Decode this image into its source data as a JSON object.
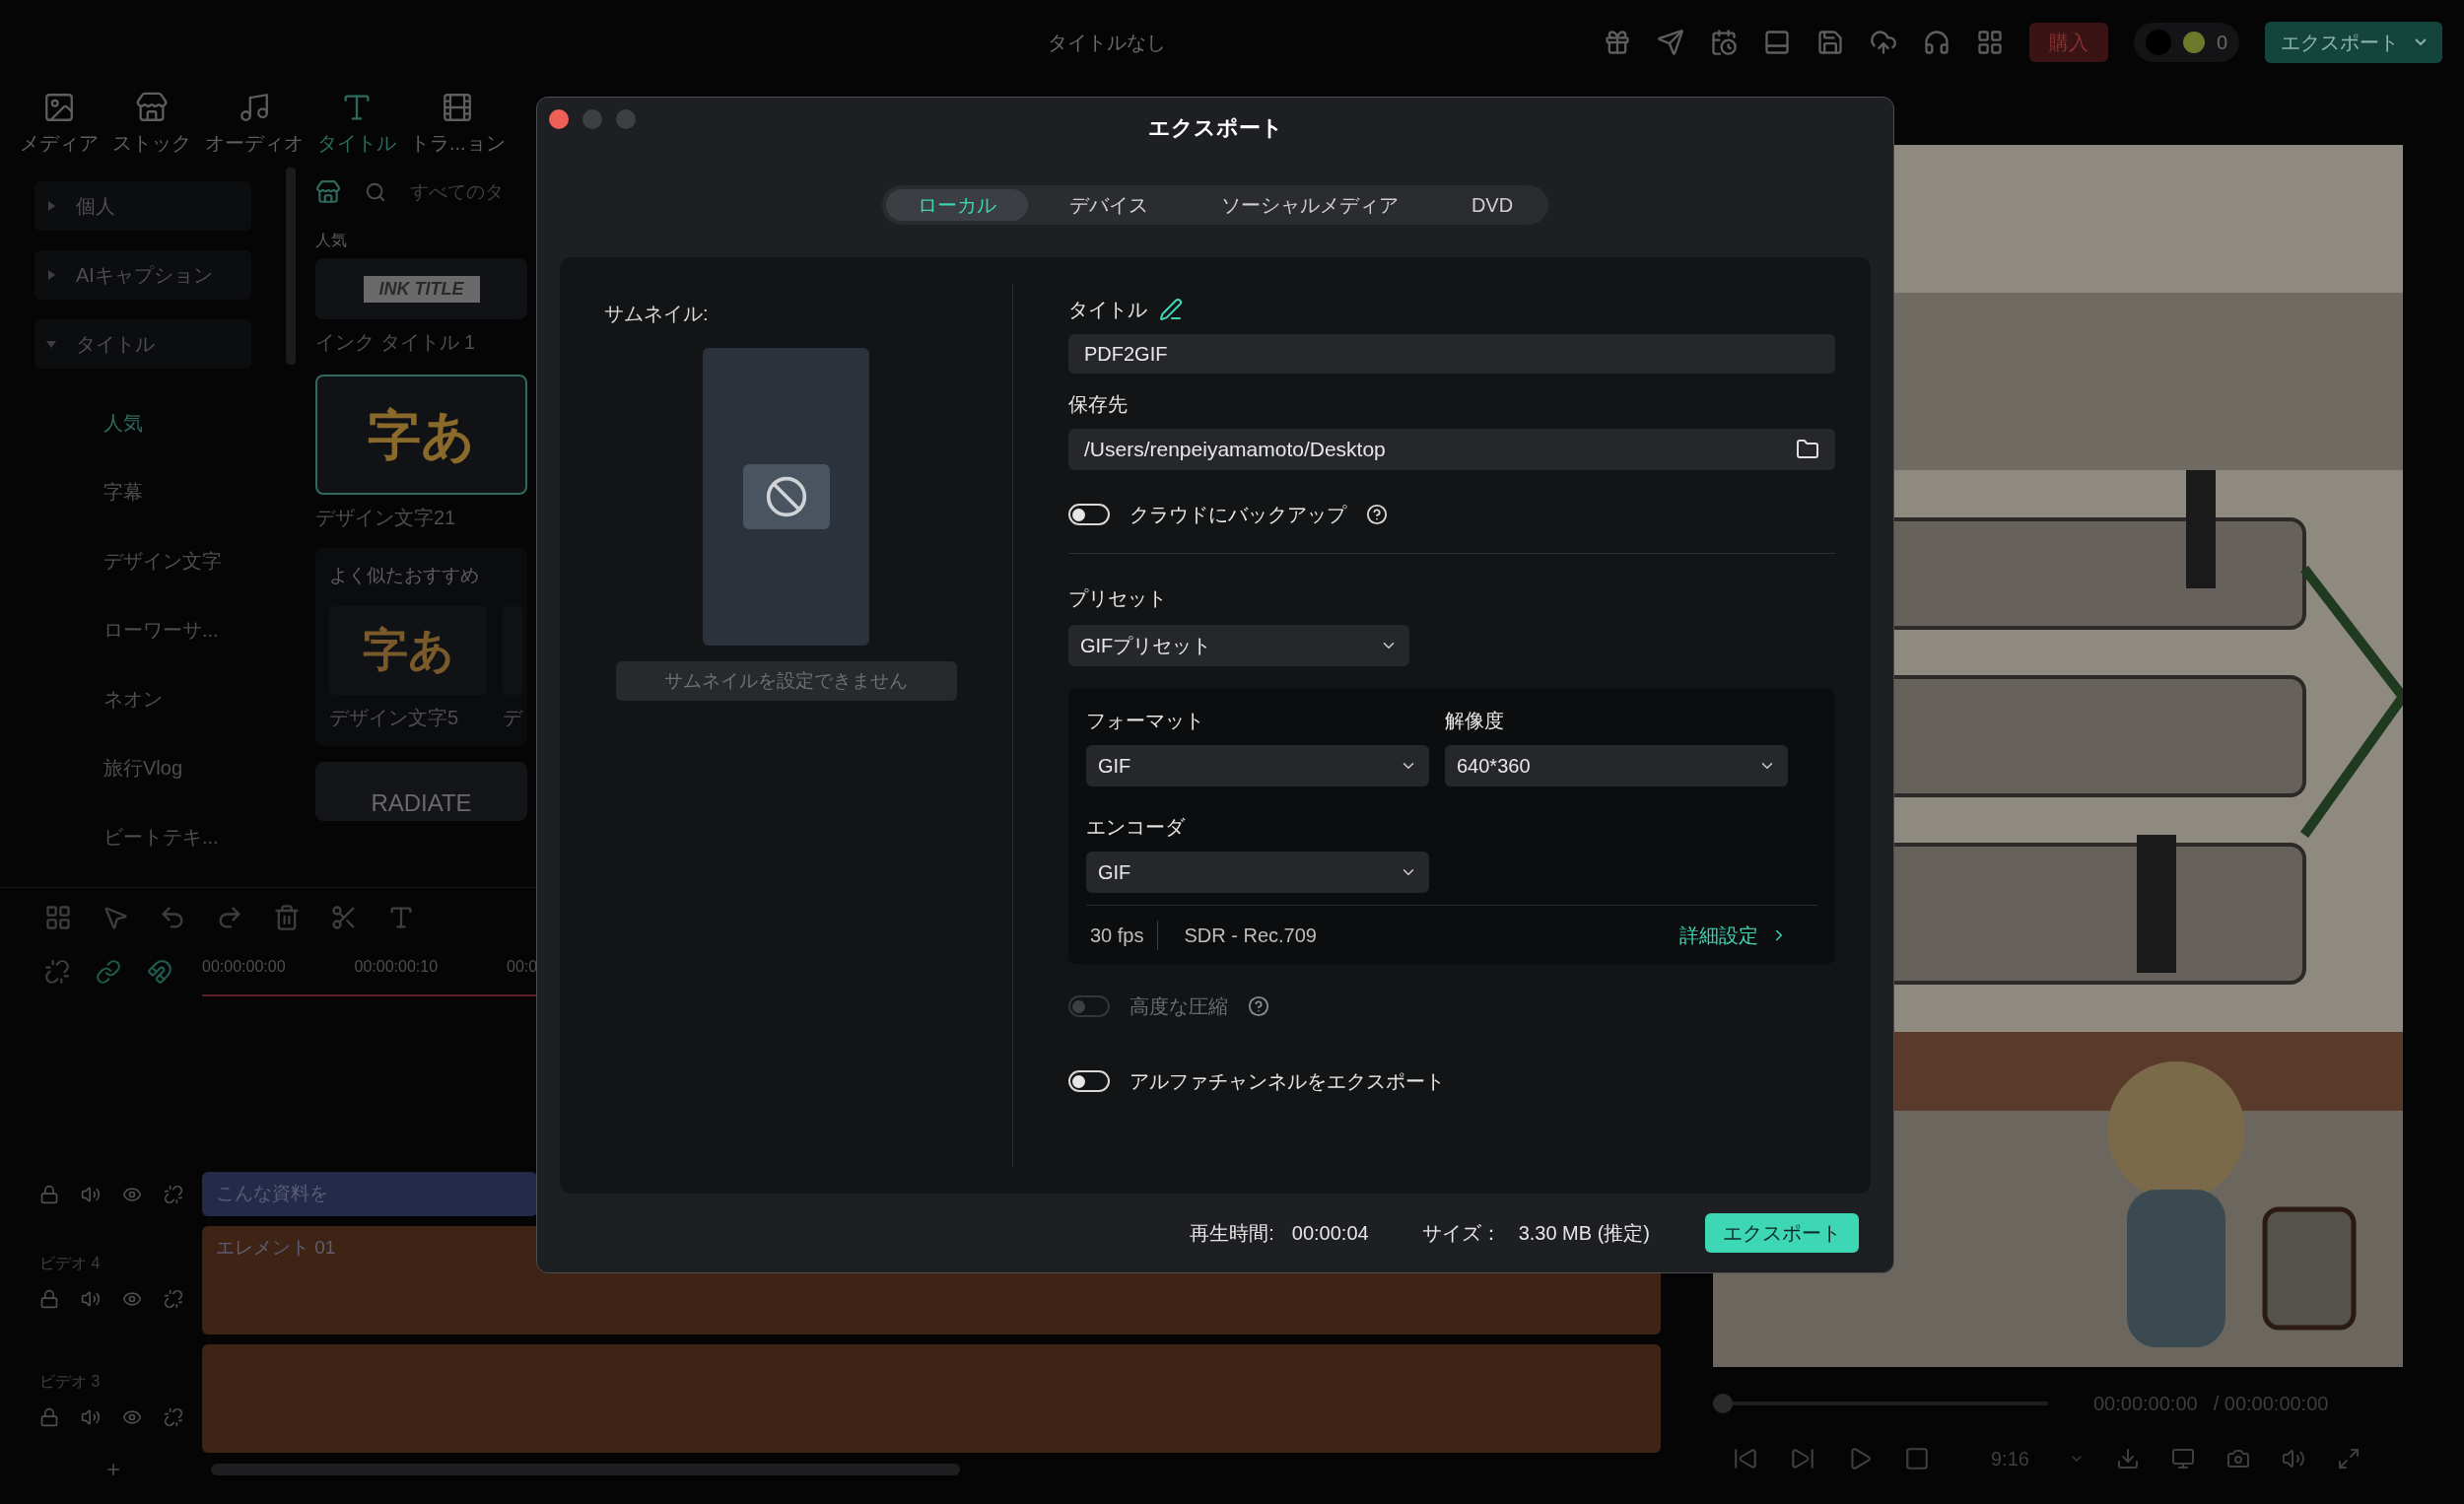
{
  "app": {
    "project_title": "タイトルなし",
    "buy_button": "購入",
    "credits": "0",
    "export_button": "エクスポート"
  },
  "media_tabs": [
    {
      "label": "メディア",
      "selected": false
    },
    {
      "label": "ストック",
      "selected": false
    },
    {
      "label": "オーディオ",
      "selected": false
    },
    {
      "label": "タイトル",
      "selected": true
    },
    {
      "label": "トラ...ョン",
      "selected": false
    }
  ],
  "sidebar": {
    "items": [
      {
        "label": "個人",
        "expanded": false
      },
      {
        "label": "AIキャプション",
        "expanded": false
      },
      {
        "label": "タイトル",
        "expanded": true,
        "children": [
          {
            "label": "人気",
            "selected": true
          },
          {
            "label": "字幕",
            "selected": false
          },
          {
            "label": "デザイン文字",
            "selected": false
          },
          {
            "label": "ローワーサ...",
            "selected": false
          },
          {
            "label": "ネオン",
            "selected": false
          },
          {
            "label": "旅行Vlog",
            "selected": false
          },
          {
            "label": "ビートテキ...",
            "selected": false
          }
        ]
      }
    ]
  },
  "library": {
    "search_placeholder": "すべてのタ",
    "section": "人気",
    "items": [
      {
        "name": "インク タイトル 1",
        "thumb_text": "INK TITLE",
        "selected": false
      },
      {
        "name": "デザイン文字21",
        "thumb_text": "字あ",
        "selected": true
      }
    ],
    "similar": {
      "heading": "よく似たおすすめ",
      "items": [
        {
          "name": "デザイン文字5",
          "thumb_text": "字あ"
        },
        {
          "name": "デ"
        }
      ]
    },
    "last_thumb_text": "RADIATE"
  },
  "timeline": {
    "ruler": [
      "00:00:00:00",
      "00:00:00:10",
      "00:0"
    ],
    "tracks": [
      {
        "kind": "title",
        "clip": "こんな資料を"
      },
      {
        "label": "ビデオ 4",
        "kind": "element",
        "clip": "エレメント 01"
      },
      {
        "label": "ビデオ 3",
        "kind": "sticker"
      }
    ]
  },
  "preview": {
    "time_current": "00:00:00:00",
    "time_total": "/ 00:00:00:00",
    "ratio": "9:16"
  },
  "dialog": {
    "title": "エクスポート",
    "tabs": [
      {
        "label": "ローカル",
        "selected": true
      },
      {
        "label": "デバイス",
        "selected": false
      },
      {
        "label": "ソーシャルメディア",
        "selected": false
      },
      {
        "label": "DVD",
        "selected": false
      }
    ],
    "thumbnail_label": "サムネイル:",
    "thumbnail_button": "サムネイルを設定できません",
    "title_label": "タイトル",
    "title_value": "PDF2GIF",
    "save_label": "保存先",
    "save_value": "/Users/renpeiyamamoto/Desktop",
    "backup": {
      "label": "クラウドにバックアップ",
      "on": false,
      "disabled": false,
      "help": true
    },
    "preset_label": "プリセット",
    "preset_value": "GIFプリセット",
    "format_label": "フォーマット",
    "format_value": "GIF",
    "resolution_label": "解像度",
    "resolution_value": "640*360",
    "encoder_label": "エンコーダ",
    "encoder_value": "GIF",
    "fps": "30 fps",
    "color_space": "SDR - Rec.709",
    "advanced_link": "詳細設定",
    "toggles": [
      {
        "label": "高度な圧縮",
        "on": false,
        "disabled": true,
        "help": true
      },
      {
        "label": "アルファチャンネルをエクスポート",
        "on": false,
        "disabled": false
      }
    ],
    "duration_label": "再生時間:",
    "duration": "00:00:04",
    "size_label": "サイズ：",
    "size": "3.30 MB (推定)",
    "export_button": "エクスポート"
  }
}
